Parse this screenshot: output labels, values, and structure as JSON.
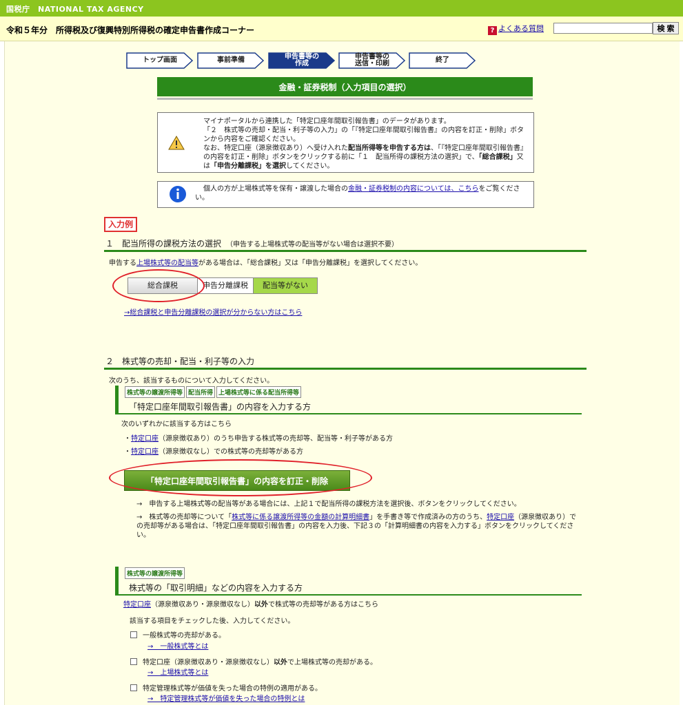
{
  "header": {
    "agency": "国税庁　NATIONAL TAX AGENCY",
    "title": "令和５年分　所得税及び復興特別所得税の確定申告書作成コーナー",
    "faq_label": "よくある質問",
    "search_placeholder": "",
    "search_button": "検 索"
  },
  "steps": [
    {
      "line1": "トップ画面",
      "line2": ""
    },
    {
      "line1": "事前準備",
      "line2": ""
    },
    {
      "line1": "申告書等の",
      "line2": "作成"
    },
    {
      "line1": "申告書等の",
      "line2": "送信・印刷"
    },
    {
      "line1": "終了",
      "line2": ""
    }
  ],
  "banner": "金融・証券税制（入力項目の選択）",
  "warning": {
    "l1": "マイナポータルから連携した「特定口座年間取引報告書」のデータがあります。",
    "l2": "「２　株式等の売却・配当・利子等の入力」の「『特定口座年間取引報告書』の内容を訂正・削除」ボタンから内容をご確認ください。",
    "l3a": "なお、特定口座（源泉徴収あり）へ受け入れた",
    "l3b": "配当所得等を申告する方は",
    "l3c": "、「『特定口座年間取引報告書』の内容を訂正・削除」ボタンをクリックする前に「１　配当所得の課税方法の選択」で、",
    "l3d": "「総合課税」",
    "l3e": "又は",
    "l3f": "「申告分離課税」を選択",
    "l3g": "してください。"
  },
  "info": {
    "pre": "個人の方が上場株式等を保有・譲渡した場合の",
    "link": "金融・証券税制の内容については、こちら",
    "post": "をご覧ください。"
  },
  "example_label": "入力例",
  "section1": {
    "title": "１　配当所得の課税方法の選択",
    "note": "（申告する上場株式等の配当等がない場合は選択不要）",
    "desc_pre": "申告する",
    "desc_link": "上場株式等の配当等",
    "desc_post": "がある場合は、「総合課税」又は「申告分離課税」を選択してください。",
    "opt_sogo": "総合課税",
    "opt_bunri": "申告分離課税",
    "opt_none": "配当等がない",
    "help_link": "→総合課税と申告分離課税の選択が分からない方はこちら"
  },
  "section2": {
    "title": "２　株式等の売却・配当・利子等の入力",
    "desc": "次のうち、該当するものについて入力してください。",
    "tags": [
      "株式等の譲渡所得等",
      "配当所得",
      "上場株式等に係る配当所得等"
    ],
    "sub1_title": "「特定口座年間取引報告書」の内容を入力する方",
    "sub1_desc": "次のいずれかに該当する方はこちら",
    "item1_link": "特定口座",
    "item1_text": "（源泉徴収あり）のうち申告する株式等の売却等、配当等・利子等がある方",
    "item2_link": "特定口座",
    "item2_text": "（源泉徴収なし）での株式等の売却等がある方",
    "big_button": "「特定口座年間取引報告書」の内容を訂正・削除",
    "note1": "→　申告する上場株式等の配当等がある場合には、上記１で配当所得の課税方法を選択後、ボタンをクリックしてください。",
    "note2_pre": "→　株式等の売却等について「",
    "note2_link": "株式等に係る譲渡所得等の金額の計算明細書",
    "note2_mid": "」を手書き等で作成済みの方のうち、",
    "note2_link2": "特定口座",
    "note2_post": "（源泉徴収あり）での売却等がある場合は、「特定口座年間取引報告書」の内容を入力後、下記３の「計算明細書の内容を入力する」ボタンをクリックしてください。",
    "tag2": "株式等の譲渡所得等",
    "sub2_title": "株式等の「取引明細」などの内容を入力する方",
    "sub2_desc_link": "特定口座",
    "sub2_desc_mid": "（源泉徴収あり・源泉徴収なし）",
    "sub2_desc_bold": "以外",
    "sub2_desc_post": "で株式等の売却等がある方はこちら",
    "check_desc": "該当する項目をチェックした後、入力してください。",
    "cb1": "一般株式等の売却がある。",
    "cb1_link": "→　一般株式等とは",
    "cb2_pre": "特定口座（源泉徴収あり・源泉徴収なし）",
    "cb2_bold": "以外",
    "cb2_post": "で上場株式等の売却がある。",
    "cb2_link": "→　上場株式等とは",
    "cb3": "特定管理株式等が価値を失った場合の特例の適用がある。",
    "cb3_link": "→　特定管理株式等が価値を失った場合の特例とは"
  },
  "colors": {
    "green": "#2b8a1a",
    "lime": "#8cc51f",
    "cream": "#ffffe6",
    "navy": "#1a3a8a",
    "red": "#e0202a"
  }
}
